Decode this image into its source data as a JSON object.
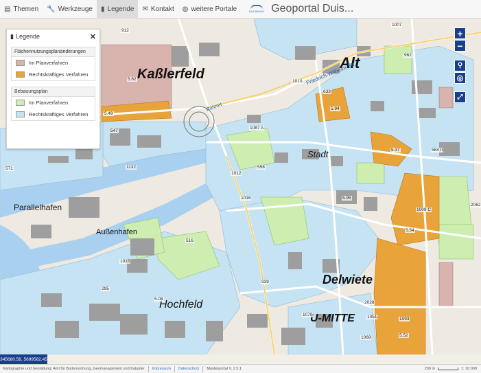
{
  "menu": {
    "items": [
      {
        "label": "Themen",
        "icon": "themes-icon",
        "glyph": "▤",
        "active": false
      },
      {
        "label": "Werkzeuge",
        "icon": "wrench-icon",
        "glyph": "🔧",
        "active": false
      },
      {
        "label": "Legende",
        "icon": "legend-icon",
        "glyph": "▮",
        "active": true
      },
      {
        "label": "Kontakt",
        "icon": "envelope-icon",
        "glyph": "✉",
        "active": false
      },
      {
        "label": "weitere Portale",
        "icon": "globe-icon",
        "glyph": "◍",
        "active": false
      }
    ],
    "logo_text": "DUISBURG",
    "portal_title": "Geoportal Duis..."
  },
  "legend": {
    "title": "Legende",
    "sections": [
      {
        "title": "Flächennutzungsplanänderungen",
        "items": [
          {
            "label": "Im Planverfahren",
            "color": "#d9b3ad"
          },
          {
            "label": "Rechtskräftiges Verfahren",
            "color": "#e8a33a"
          }
        ]
      },
      {
        "title": "Bebauungsplan",
        "items": [
          {
            "label": "Im Planverfahren",
            "color": "#cdeeb0"
          },
          {
            "label": "Rechtskräftiges Verfahren",
            "color": "#c6e3f3"
          }
        ]
      }
    ]
  },
  "controls": {
    "zoom_in": "+",
    "zoom_out": "−",
    "locate": "📍",
    "target": "◎",
    "fullscreen": "⛶"
  },
  "map": {
    "place_labels": [
      "Alt",
      "Kaßlerfeld",
      "Stadt",
      "Delwiete",
      "U-MITTE",
      "Hochfeld",
      "Parallelhafen",
      "Außenhafen"
    ],
    "plan_numbers": [
      "912",
      "1007",
      "962",
      "1010",
      "633",
      "5.62",
      "5.49",
      "1087 A",
      "547",
      "5.94",
      "5.37",
      "584 II",
      "1132",
      "1012",
      "558",
      "571",
      "1016",
      "5.95",
      "1009 C",
      "2062",
      "5.54",
      "516",
      "1015",
      "295",
      "5.08",
      "1070",
      "1051",
      "1093",
      "5.52",
      "939",
      "2028",
      "1069"
    ],
    "street_labels": [
      "Friedrich-Wilhelm-Str.",
      "Ruhrort"
    ]
  },
  "coordinates": "345680.58, 5699562.45",
  "footer": {
    "credit": "Kartographie und Gestaltung: Amt für Bodenordnung, Geomanagement und Kataster",
    "impressum": "Impressum",
    "datenschutz": "Datenschutz",
    "version": "Masterportal V. 2.5.1",
    "scale_label": "200 m",
    "scale_ratio": "1: 10 000"
  }
}
